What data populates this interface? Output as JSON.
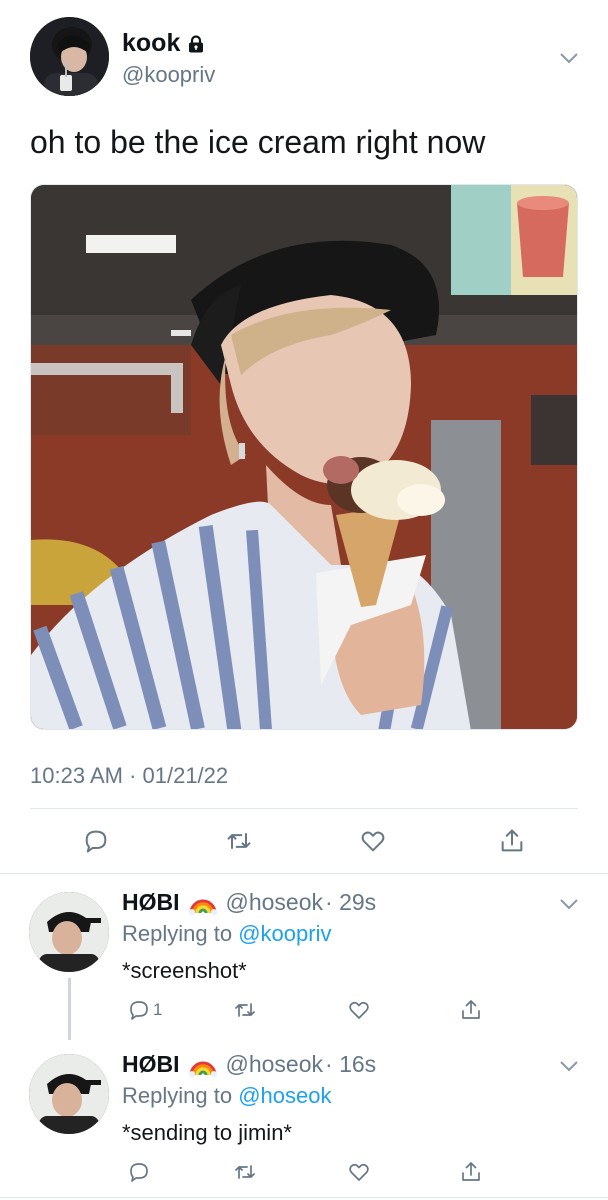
{
  "main_tweet": {
    "name": "kook",
    "handle": "@koopriv",
    "text": "oh to be the ice cream right now",
    "timestamp": "10:23 AM · 01/21/22",
    "protected": true
  },
  "replies": [
    {
      "name": "HØBI",
      "emoji": "rainbow",
      "handle": "@hoseok",
      "time": "· 29s",
      "replying_label": "Replying to",
      "replying_to": "@koopriv",
      "text": "*screenshot*",
      "reply_count": "1"
    },
    {
      "name": "HØBI",
      "emoji": "rainbow",
      "handle": "@hoseok",
      "time": "· 16s",
      "replying_label": "Replying to",
      "replying_to": "@hoseok",
      "text": "*sending to jimin*",
      "reply_count": ""
    }
  ],
  "icons": {
    "reply": "reply-icon",
    "retweet": "retweet-icon",
    "like": "heart-icon",
    "share": "share-icon",
    "more": "chevron-down-icon",
    "lock": "lock-icon"
  },
  "colors": {
    "link": "#1da1f2",
    "muted": "#657786",
    "divider": "#e1e8ed"
  }
}
